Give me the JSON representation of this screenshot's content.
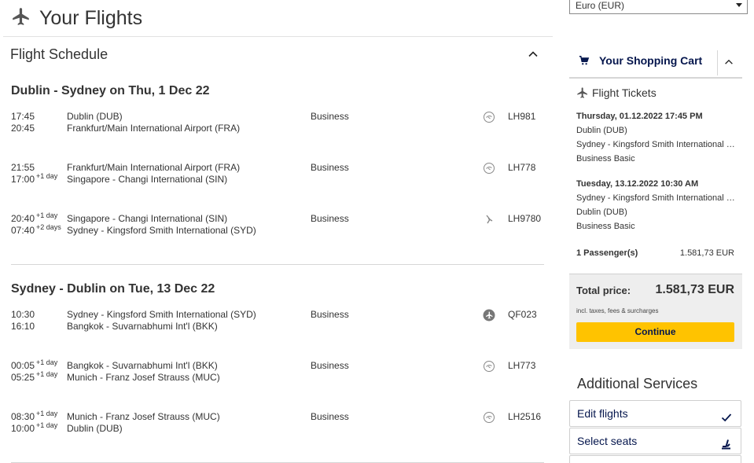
{
  "header": {
    "title": "Your Flights",
    "icon": "airplane-icon"
  },
  "schedule": {
    "title": "Flight Schedule",
    "journeys": [
      {
        "title": "Dublin - Sydney on Thu, 1 Dec 22",
        "segments": [
          {
            "dep_time": "17:45",
            "dep_offset": "",
            "arr_time": "20:45",
            "arr_offset": "",
            "from": "Dublin (DUB)",
            "to": "Frankfurt/Main International Airport (FRA)",
            "cabin": "Business",
            "carrier_icon": "lufthansa-crane-icon",
            "flight": "LH981"
          },
          {
            "dep_time": "21:55",
            "dep_offset": "",
            "arr_time": "17:00",
            "arr_offset": "+1 day",
            "from": "Frankfurt/Main International Airport (FRA)",
            "to": "Singapore - Changi International (SIN)",
            "cabin": "Business",
            "carrier_icon": "lufthansa-crane-icon",
            "flight": "LH778"
          },
          {
            "dep_time": "20:40",
            "dep_offset": "+1 day",
            "arr_time": "07:40",
            "arr_offset": "+2 days",
            "from": "Singapore - Changi International (SIN)",
            "to": "Sydney - Kingsford Smith International (SYD)",
            "cabin": "Business",
            "carrier_icon": "singapore-airlines-bird-icon",
            "flight": "LH9780"
          }
        ]
      },
      {
        "title": "Sydney - Dublin on Tue, 13 Dec 22",
        "segments": [
          {
            "dep_time": "10:30",
            "dep_offset": "",
            "arr_time": "16:10",
            "arr_offset": "",
            "from": "Sydney - Kingsford Smith International (SYD)",
            "to": "Bangkok - Suvarnabhumi Int'l (BKK)",
            "cabin": "Business",
            "carrier_icon": "operating-airline-plane-icon",
            "flight": "QF023"
          },
          {
            "dep_time": "00:05",
            "dep_offset": "+1 day",
            "arr_time": "05:25",
            "arr_offset": "+1 day",
            "from": "Bangkok - Suvarnabhumi Int'l (BKK)",
            "to": "Munich - Franz Josef Strauss (MUC)",
            "cabin": "Business",
            "carrier_icon": "lufthansa-crane-icon",
            "flight": "LH773"
          },
          {
            "dep_time": "08:30",
            "dep_offset": "+1 day",
            "arr_time": "10:00",
            "arr_offset": "+1 day",
            "from": "Munich - Franz Josef Strauss (MUC)",
            "to": "Dublin (DUB)",
            "cabin": "Business",
            "carrier_icon": "lufthansa-crane-icon",
            "flight": "LH2516"
          }
        ]
      }
    ]
  },
  "currency": {
    "selected": "Euro (EUR)"
  },
  "cart": {
    "title": "Your Shopping Cart",
    "tickets_title": "Flight Tickets",
    "outbound": {
      "datetime": "Thursday, 01.12.2022 17:45 PM",
      "from": "Dublin (DUB)",
      "to": "Sydney - Kingsford Smith International (SYD)",
      "fare": "Business Basic"
    },
    "inbound": {
      "datetime": "Tuesday, 13.12.2022 10:30 AM",
      "from": "Sydney - Kingsford Smith International (SYD)",
      "to": "Dublin (DUB)",
      "fare": "Business Basic"
    },
    "passengers": "1 Passenger(s)",
    "passengers_amount": "1.581,73 EUR",
    "total_label": "Total price:",
    "total_amount": "1.581,73 EUR",
    "incl_note": "incl. taxes, fees & surcharges",
    "continue_label": "Continue"
  },
  "additional": {
    "title": "Additional Services",
    "edit_flights": "Edit flights",
    "select_seats": "Select seats"
  },
  "colors": {
    "brand_navy": "#05164d",
    "accent_yellow": "#ffc300",
    "panel_grey": "#eeeeee"
  }
}
